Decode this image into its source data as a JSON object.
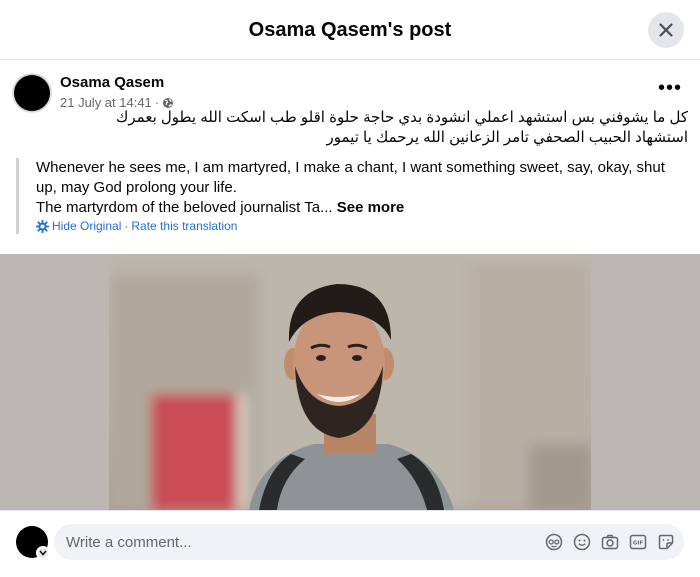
{
  "header": {
    "title": "Osama Qasem's post"
  },
  "post": {
    "author": "Osama Qasem",
    "date": "21 July at 14:41",
    "separator": "·",
    "text_line1": "كل ما يشوفني بس استشهد اعملي انشودة بدي حاجة حلوة اقلو طب اسكت الله يطول بعمرك",
    "text_line2": "استشهاد الحبيب الصحفي تامر الزعانين الله يرحمك يا تيمور",
    "translation": {
      "line1": "Whenever he sees me, I am martyred, I make a chant, I want something sweet, say, okay, shut up, may God prolong your life.",
      "line2": "The martyrdom of the beloved journalist Ta...",
      "see_more": "See more",
      "hide_original": "Hide Original",
      "link_separator": "·",
      "rate_translation": "Rate this translation"
    }
  },
  "composer": {
    "placeholder": "Write a comment..."
  },
  "icons": {
    "close": "close-icon",
    "more": "more-options-icon",
    "globe": "globe-icon",
    "settings": "gear-icon",
    "avatar": "avatar-icon",
    "sticker_face": "avatar-sticker-icon",
    "emoji": "emoji-icon",
    "camera": "camera-icon",
    "gif": "gif-icon",
    "sticker": "sticker-icon"
  },
  "colors": {
    "link": "#216fdb",
    "secondary_text": "#65676b",
    "button_bg": "#e4e6eb"
  }
}
